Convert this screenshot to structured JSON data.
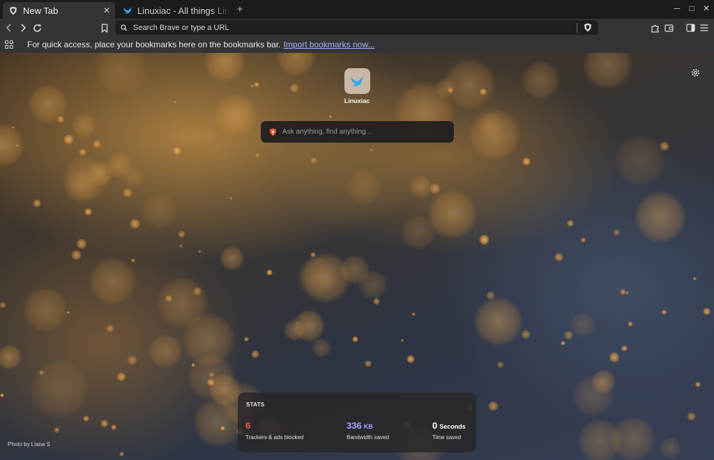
{
  "tabs": [
    {
      "title": "New Tab",
      "active": true,
      "favicon": "brave-shield-icon"
    },
    {
      "title": "Linuxiac - All things Linux",
      "active": false,
      "favicon": "linuxiac-bird-icon"
    }
  ],
  "tabstrip": {
    "new_tab_glyph": "+",
    "close_glyph": "✕",
    "minimize_glyph": "─",
    "maximize_glyph": "□",
    "close_window_glyph": "✕"
  },
  "toolbar": {
    "search": {
      "placeholder": "Search Brave or type a URL",
      "value": ""
    }
  },
  "bookmarks_bar": {
    "message": "For quick access, place your bookmarks here on the bookmarks bar.",
    "link": "Import bookmarks now..."
  },
  "ntp": {
    "top_site": {
      "name": "Linuxiac"
    },
    "ask": {
      "placeholder": "Ask anything, find anything..."
    },
    "photo_credit": "Photo by Liana S",
    "stats": {
      "title": "STATS",
      "trackers": {
        "value": "6",
        "label": "Trackers & ads blocked"
      },
      "bandwidth": {
        "value": "336",
        "unit": "KB",
        "label": "Bandwidth saved"
      },
      "time": {
        "value": "0",
        "unit": "Seconds",
        "label": "Time saved"
      }
    }
  },
  "colors": {
    "accent_orange": "#fb5a3d",
    "accent_purple": "#a1a7ff",
    "chrome_dark": "#1b1b1d",
    "chrome": "#343436",
    "link": "#a8b4ff"
  }
}
